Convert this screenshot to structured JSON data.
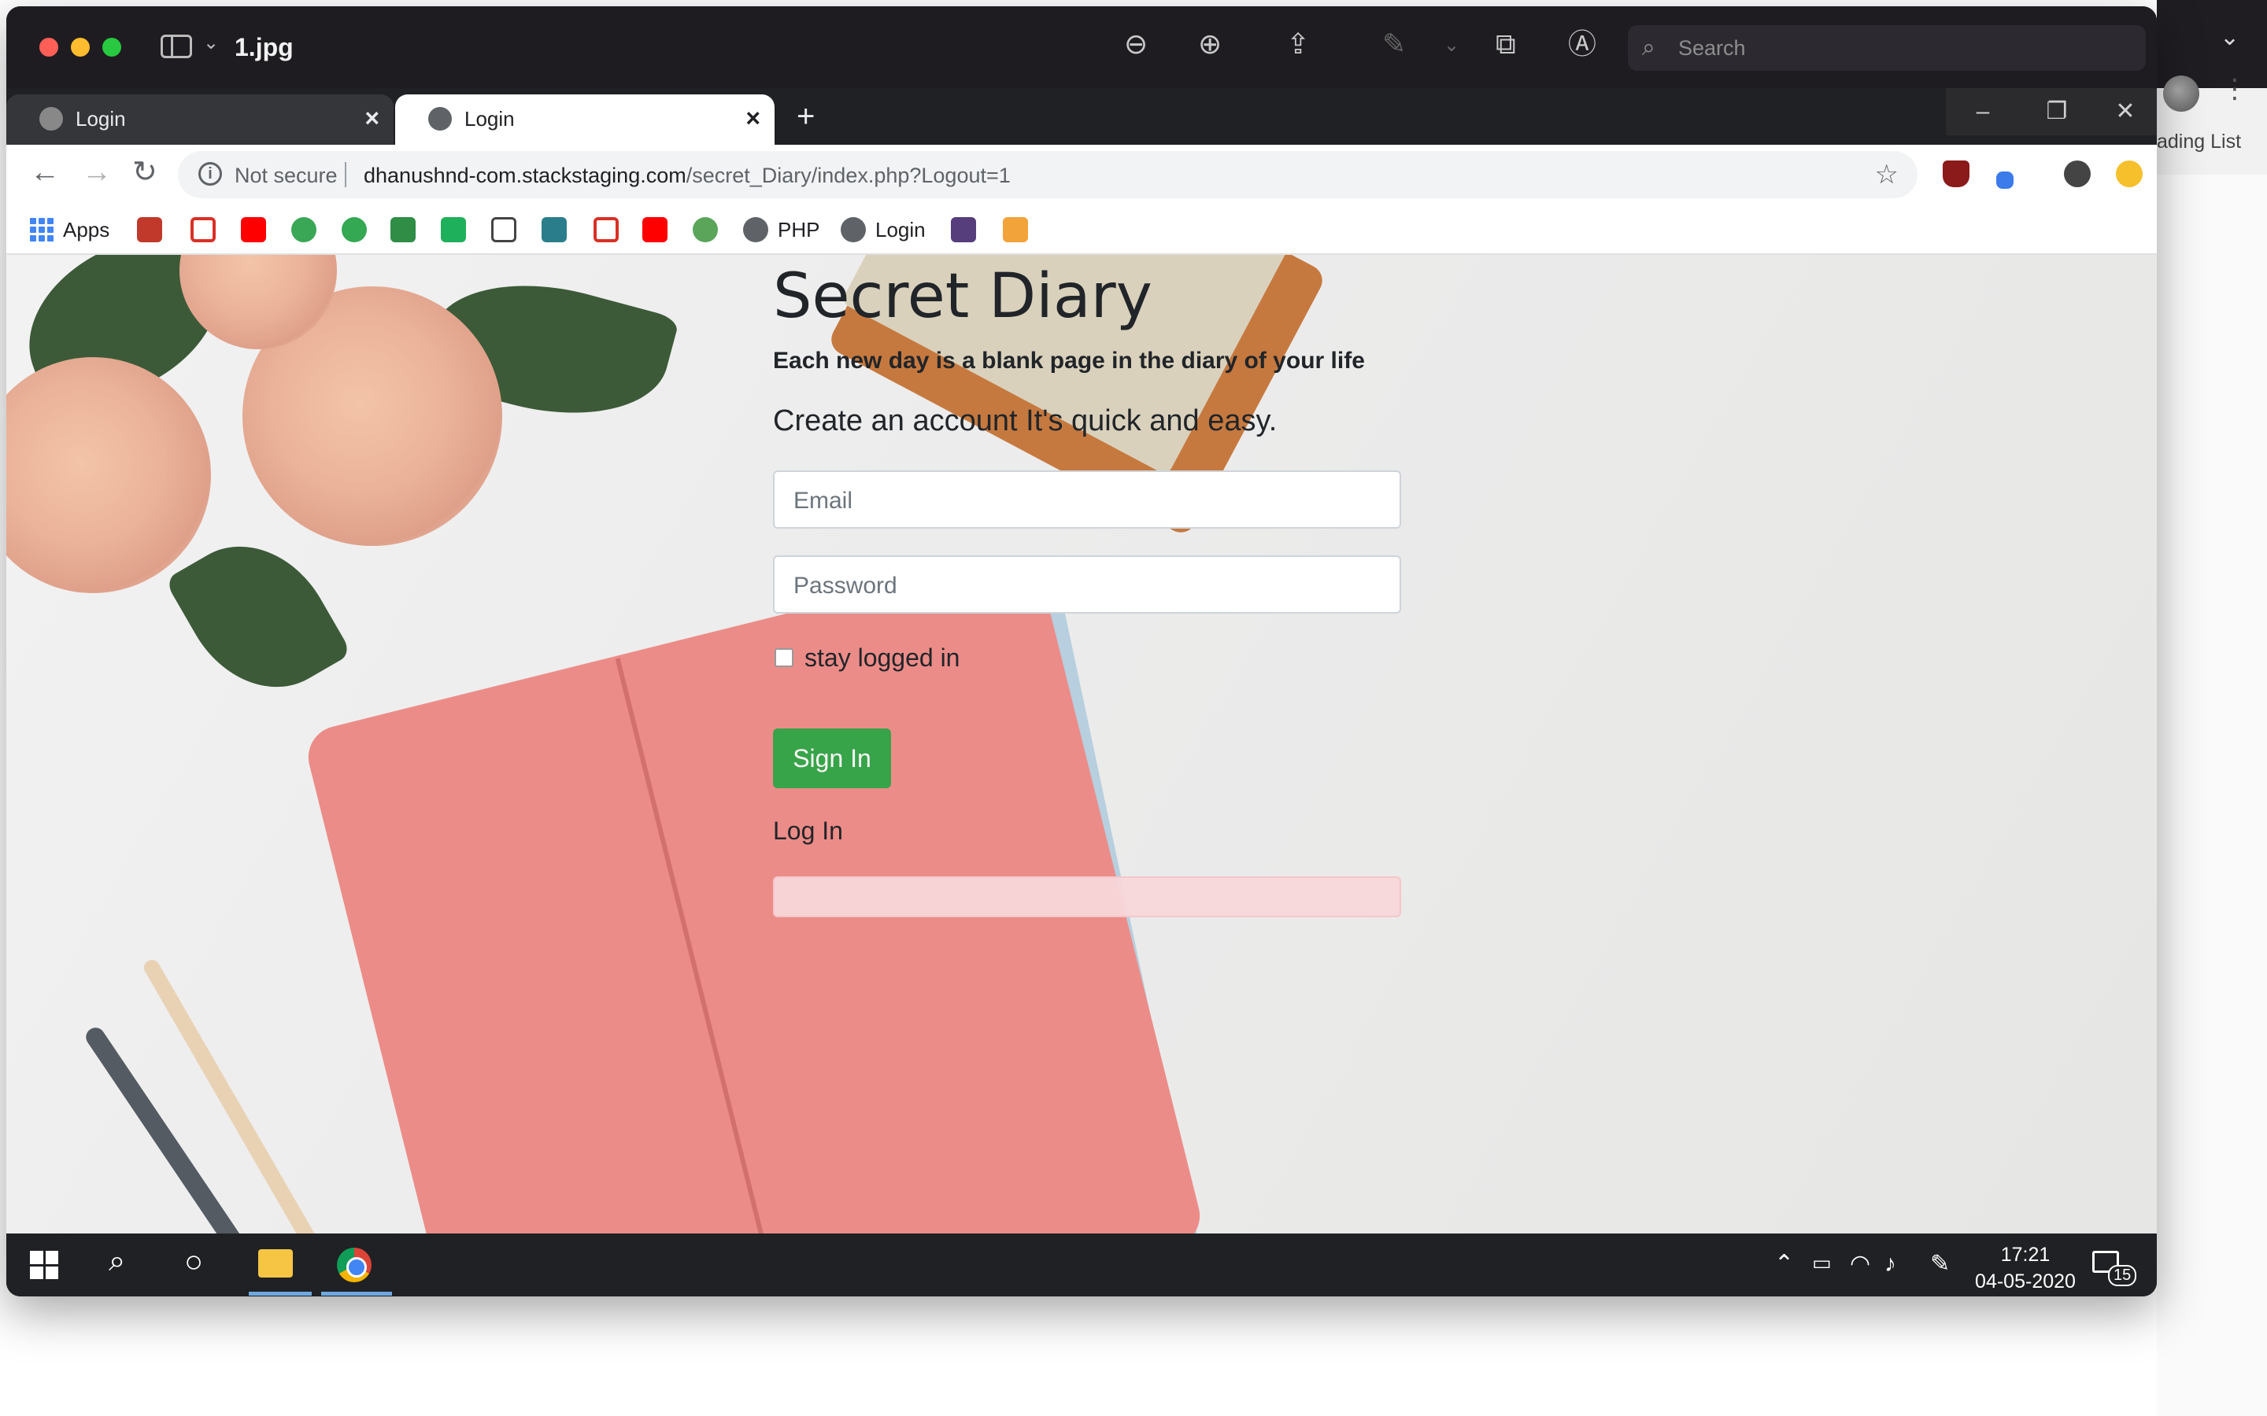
{
  "mac": {
    "title": "1.jpg",
    "search_placeholder": "Search",
    "icons": [
      "zoom-out-icon",
      "zoom-in-icon",
      "share-icon",
      "markup-icon",
      "rotate-icon",
      "annotate-icon"
    ]
  },
  "side": {
    "reading_list": "ading List"
  },
  "browser": {
    "tabs": [
      {
        "label": "Login",
        "active": false
      },
      {
        "label": "Login",
        "active": true
      }
    ],
    "omnibox": {
      "security": "Not secure",
      "host": "dhanushnd-com.stackstaging.com",
      "path": "/secret_Diary/index.php?Logout=1"
    },
    "bookmarks": {
      "apps": "Apps",
      "php": "PHP",
      "login": "Login"
    }
  },
  "page": {
    "title": "Secret Diary",
    "tagline": "Each new day is a blank page in the diary of your life",
    "create": "Create an account It's quick and easy.",
    "email_placeholder": "Email",
    "password_placeholder": "Password",
    "stay_logged_in": "stay logged in",
    "sign_in": "Sign In",
    "log_in": "Log In"
  },
  "taskbar": {
    "time": "17:21",
    "date": "04-05-2020",
    "notifications": "15"
  },
  "colors": {
    "primary_button": "#28a745",
    "alert_bg": "#f8d7da",
    "tab_strip": "#202124"
  }
}
